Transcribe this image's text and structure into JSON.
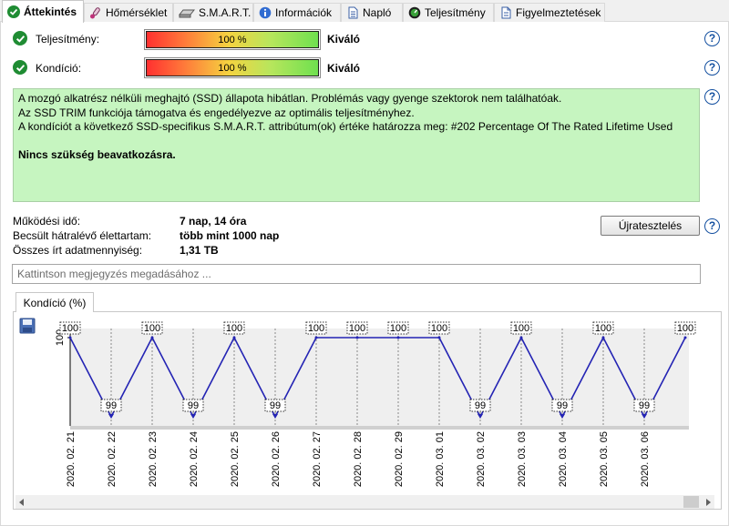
{
  "tabs": [
    {
      "label": "Áttekintés",
      "icon": "green-check-icon",
      "active": true
    },
    {
      "label": "Hőmérséklet",
      "icon": "thermometer-icon",
      "active": false
    },
    {
      "label": "S.M.A.R.T.",
      "icon": "drive-icon",
      "active": false
    },
    {
      "label": "Információk",
      "icon": "info-icon",
      "active": false
    },
    {
      "label": "Napló",
      "icon": "log-document-icon",
      "active": false
    },
    {
      "label": "Teljesítmény",
      "icon": "speedometer-icon",
      "active": false
    },
    {
      "label": "Figyelmeztetések",
      "icon": "alerts-document-icon",
      "active": false
    }
  ],
  "performance": {
    "label": "Teljesítmény:",
    "bar_text": "100 %",
    "percent": 100,
    "rating": "Kiváló"
  },
  "health": {
    "label": "Kondíció:",
    "bar_text": "100 %",
    "percent": 100,
    "rating": "Kiváló"
  },
  "status": {
    "lines": [
      "A mozgó alkatrész nélküli meghajtó (SSD) állapota hibátlan. Problémás vagy gyenge szektorok nem találhatóak.",
      "Az SSD TRIM funkciója támogatva és engedélyezve az optimális teljesítményhez.",
      "A kondíciót a következő SSD-specifikus S.M.A.R.T. attribútum(ok) értéke határozza meg:  #202 Percentage Of The Rated Lifetime Used"
    ],
    "conclusion": "Nincs szükség beavatkozásra."
  },
  "info": {
    "uptime_label": "Működési idő:",
    "uptime_value": "7 nap, 14 óra",
    "lifetime_label": "Becsült hátralévő élettartam:",
    "lifetime_value": "több mint 1000 nap",
    "written_label": "Összes írt adatmennyiség:",
    "written_value": "1,31 TB"
  },
  "retest_button": "Újratesztelés",
  "comment_placeholder": "Kattintson megjegyzés megadásához ...",
  "chart_tab": "Kondíció  (%)",
  "colors": {
    "line": "#2424b4",
    "status_bg": "#c6f5c0",
    "check": "#1f8c33",
    "help": "#1450a0"
  },
  "chart_data": {
    "type": "line",
    "series": [
      {
        "values": [
          100,
          99,
          100,
          99,
          100,
          99,
          100,
          100,
          100,
          100,
          99,
          100,
          99,
          100,
          99,
          100
        ]
      }
    ],
    "x": [
      "2020. 02. 21",
      "2020. 02. 22",
      "2020. 02. 23",
      "2020. 02. 24",
      "2020. 02. 25",
      "2020. 02. 26",
      "2020. 02. 27",
      "2020. 02. 28",
      "2020. 02. 29",
      "2020. 03. 01",
      "2020. 03. 02",
      "2020. 03. 03",
      "2020. 03. 04",
      "2020. 03. 05",
      "2020. 03. 06"
    ],
    "y_tick_label": "100",
    "ylim": [
      99,
      100
    ],
    "grid": true
  }
}
